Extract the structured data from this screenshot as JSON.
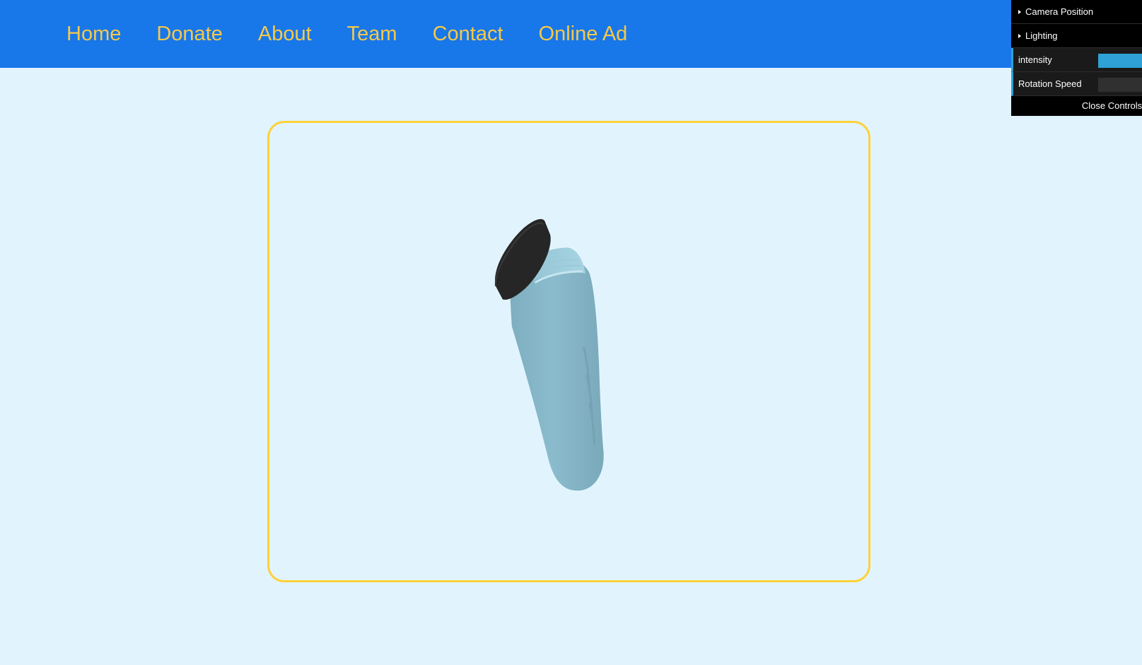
{
  "nav": {
    "items": [
      {
        "label": "Home"
      },
      {
        "label": "Donate"
      },
      {
        "label": "About"
      },
      {
        "label": "Team"
      },
      {
        "label": "Contact"
      },
      {
        "label": "Online Ad"
      }
    ]
  },
  "colors": {
    "navbar": "#1877e9",
    "nav_text": "#f5c84a",
    "page_bg": "#e1f4fe",
    "viewer_border": "#fdd13a",
    "bottle_body": "#86b6c7",
    "bottle_cap": "#252525",
    "gui_accent": "#2fa1d6"
  },
  "viewer": {
    "object_icon": "water-bottle-3d-model"
  },
  "controls": {
    "folders": [
      {
        "label": "Camera Position"
      },
      {
        "label": "Lighting"
      }
    ],
    "sliders": [
      {
        "label": "intensity",
        "value_fraction": 1.0
      },
      {
        "label": "Rotation Speed",
        "value_fraction": 0.0
      }
    ],
    "close_label": "Close Controls"
  }
}
